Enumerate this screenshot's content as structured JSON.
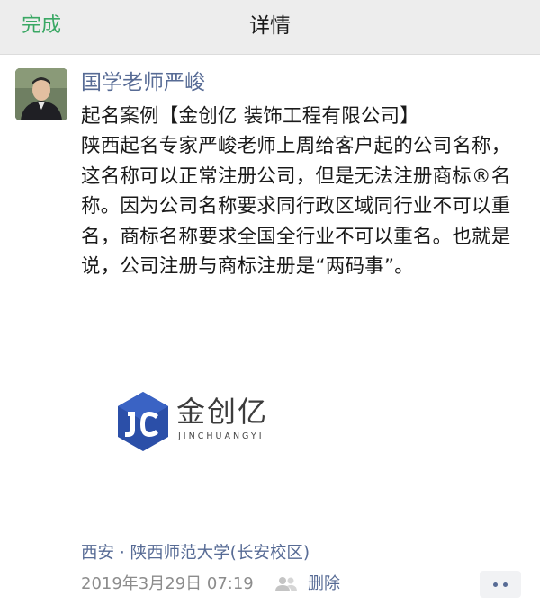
{
  "navbar": {
    "done_label": "完成",
    "title": "详情"
  },
  "post": {
    "author": "国学老师严峻",
    "text": "起名案例【金创亿 装饰工程有限公司】\n陕西起名专家严峻老师上周给客户起的公司名称，这名称可以正常注册公司，但是无法注册商标®名称。因为公司名称要求同行政区域同行业不可以重名，商标名称要求全国全行业不可以重名。也就是说，公司注册与商标注册是“两码事”。",
    "image": {
      "logo_cn": "金创亿",
      "logo_en": "JINCHUANGYI"
    },
    "location": "西安 · 陕西师范大学(长安校区)",
    "timestamp": "2019年3月29日 07:19",
    "delete_label": "删除",
    "icons": {
      "privacy": "friends-visibility-icon",
      "more": "more-icon"
    }
  },
  "colors": {
    "accent_green": "#3aa864",
    "link_blue": "#576b95",
    "logo_blue": "#2b4fa8"
  }
}
